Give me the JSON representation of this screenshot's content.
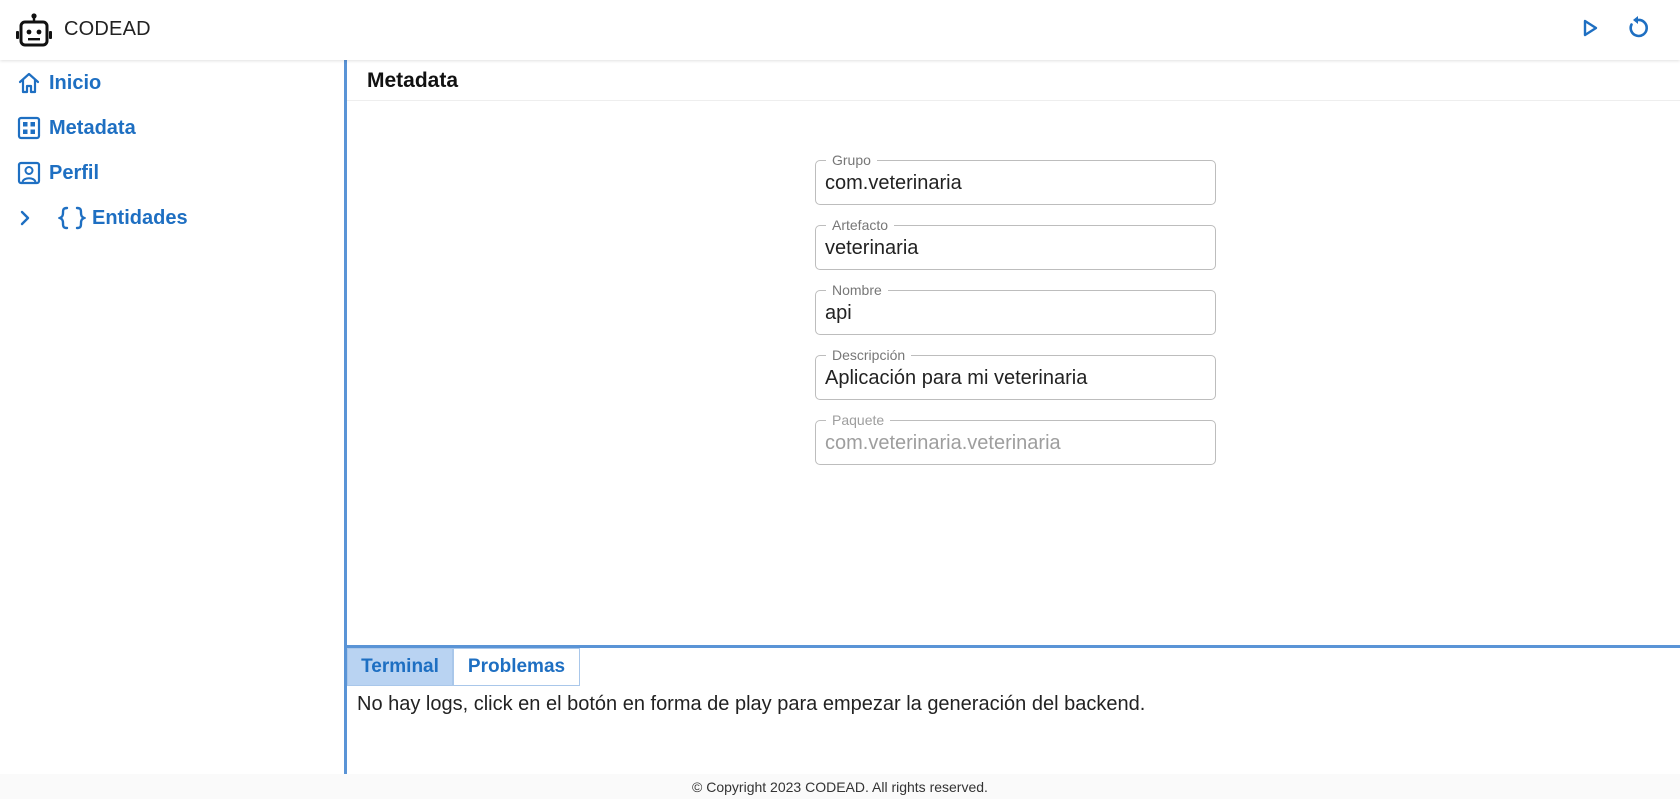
{
  "app": {
    "title": "CODEAD",
    "logo_icon": "robot-icon"
  },
  "header": {
    "play_icon": "play-icon",
    "refresh_icon": "refresh-icon"
  },
  "colors": {
    "accent": "#1e6fc2",
    "divider": "#5a94d6",
    "active_tab_bg": "#b9d3f2"
  },
  "sidebar": {
    "items": [
      {
        "label": "Inicio",
        "icon": "home-icon"
      },
      {
        "label": "Metadata",
        "icon": "grid-icon"
      },
      {
        "label": "Perfil",
        "icon": "profile-icon"
      },
      {
        "label": "Entidades",
        "icon": "braces-icon",
        "expand_icon": "chevron-right-icon"
      }
    ]
  },
  "main": {
    "title": "Metadata",
    "fields": [
      {
        "label": "Grupo",
        "value": "com.veterinaria"
      },
      {
        "label": "Artefacto",
        "value": "veterinaria"
      },
      {
        "label": "Nombre",
        "value": "api"
      },
      {
        "label": "Descripción",
        "value": "Aplicación para mi veterinaria"
      },
      {
        "label": "Paquete",
        "value": "com.veterinaria.veterinaria",
        "disabled": true
      }
    ]
  },
  "console": {
    "tabs": [
      {
        "label": "Terminal",
        "active": true
      },
      {
        "label": "Problemas",
        "active": false
      }
    ],
    "message": "No hay logs, click en el botón en forma de play para empezar la generación del backend."
  },
  "footer": {
    "text": "© Copyright 2023 CODEAD. All rights reserved."
  }
}
